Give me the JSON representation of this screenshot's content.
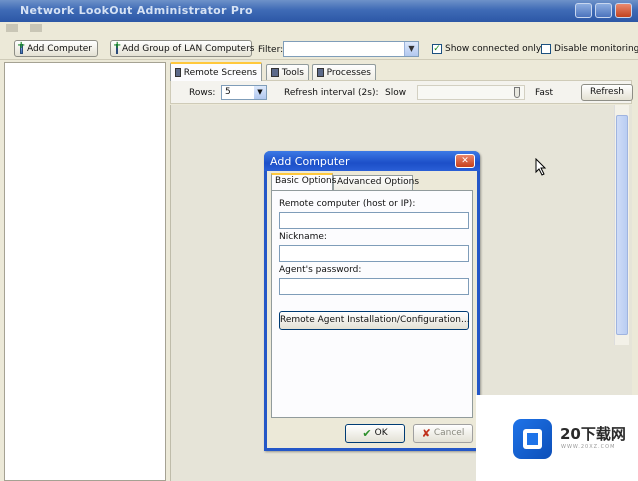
{
  "window": {
    "title": "Network LookOut Administrator Pro"
  },
  "toolbar": {
    "add_computer": "Add Computer",
    "add_group": "Add Group of LAN Computers",
    "filter_label": "Filter:",
    "filter_value": "",
    "show_connected": {
      "label": "Show connected only",
      "checked": true
    },
    "disable_monitoring": {
      "label": "Disable monitoring",
      "checked": false
    }
  },
  "tabs": [
    {
      "label": "Remote Screens",
      "icon": "monitor-icon",
      "active": true
    },
    {
      "label": "Tools",
      "icon": "tools-icon",
      "active": false
    },
    {
      "label": "Processes",
      "icon": "processes-icon",
      "active": false
    }
  ],
  "subtoolbar": {
    "rows_label": "Rows:",
    "rows_value": "5",
    "refresh_label": "Refresh interval (2s):",
    "slow_label": "Slow",
    "fast_label": "Fast",
    "refresh_button": "Refresh"
  },
  "dialog": {
    "title": "Add Computer",
    "tabs": [
      {
        "label": "Basic Options",
        "active": true
      },
      {
        "label": "Advanced Options",
        "active": false
      }
    ],
    "remote_label": "Remote computer (host or IP):",
    "remote_value": "",
    "nickname_label": "Nickname:",
    "nickname_value": "",
    "password_label": "Agent's password:",
    "password_value": "",
    "config_button": "Remote Agent Installation/Configuration...",
    "ok_button": "OK",
    "cancel_button": "Cancel"
  },
  "watermark": {
    "text": "20下载网",
    "sub": "WWW.20XZ.COM"
  },
  "colors": {
    "titlebar": "#2c57a6",
    "dialog_border": "#2457c7",
    "tab_highlight": "#ffc83c"
  }
}
